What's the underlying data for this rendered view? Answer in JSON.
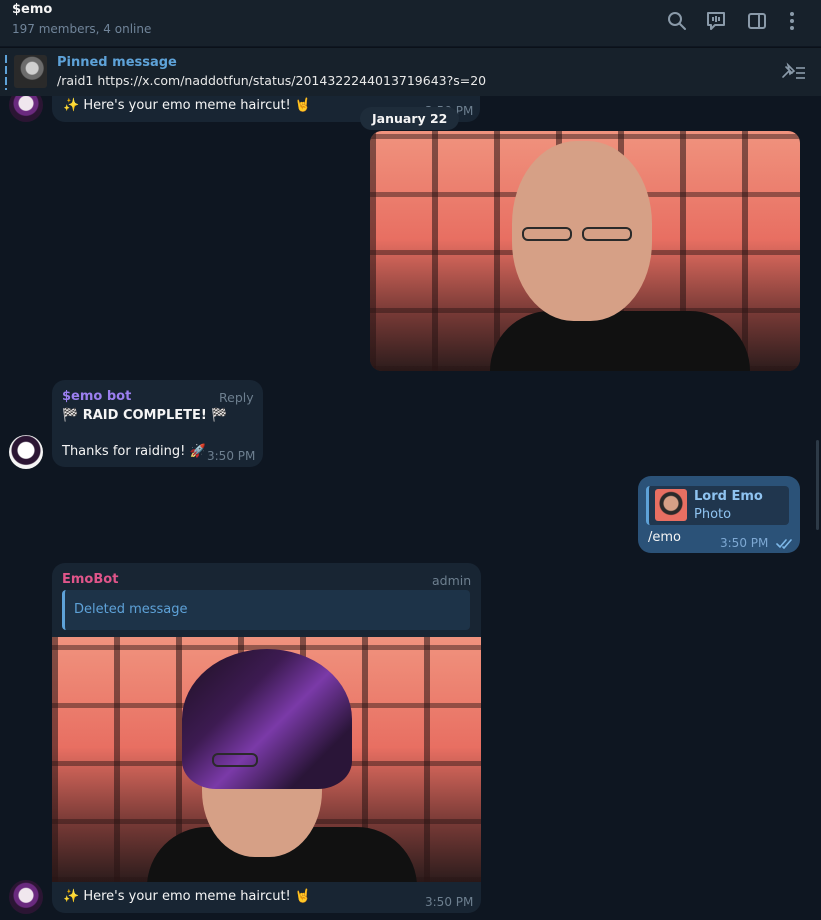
{
  "header": {
    "title": "$emo",
    "subtitle": "197 members, 4 online",
    "icons": [
      "search-icon",
      "live-stream-icon",
      "sidebar-toggle-icon",
      "more-icon"
    ]
  },
  "pinned": {
    "label": "Pinned message",
    "text": "/raid1 https://x.com/naddotfun/status/2014322244013719643?s=20",
    "icon": "pinned-list-icon"
  },
  "date_separator": "January 22",
  "messages": {
    "top_partial": {
      "text": "✨ Here's your emo meme haircut! 🤘",
      "time": "3:50 PM"
    },
    "bot": {
      "sender": "$emo bot",
      "reply_label": "Reply",
      "line1": "🏁 RAID COMPLETE! 🏁",
      "line2": "Thanks for raiding! 🚀",
      "time": "3:50 PM"
    },
    "outgoing": {
      "quote_sender": "Lord Emo",
      "quote_text": "Photo",
      "text": "/emo",
      "time": "3:50 PM"
    },
    "emobot": {
      "sender": "EmoBot",
      "role": "admin",
      "quote_text": "Deleted message",
      "caption": "✨ Here's your emo meme haircut! 🤘",
      "time": "3:50 PM"
    }
  },
  "colors": {
    "bg": "#0e1621",
    "panel": "#17212b",
    "bubble_in": "#182533",
    "bubble_out": "#2b5278",
    "accent": "#5ea2d8",
    "bot_name": "#9b7ff0",
    "emobot_name": "#e0558a"
  }
}
